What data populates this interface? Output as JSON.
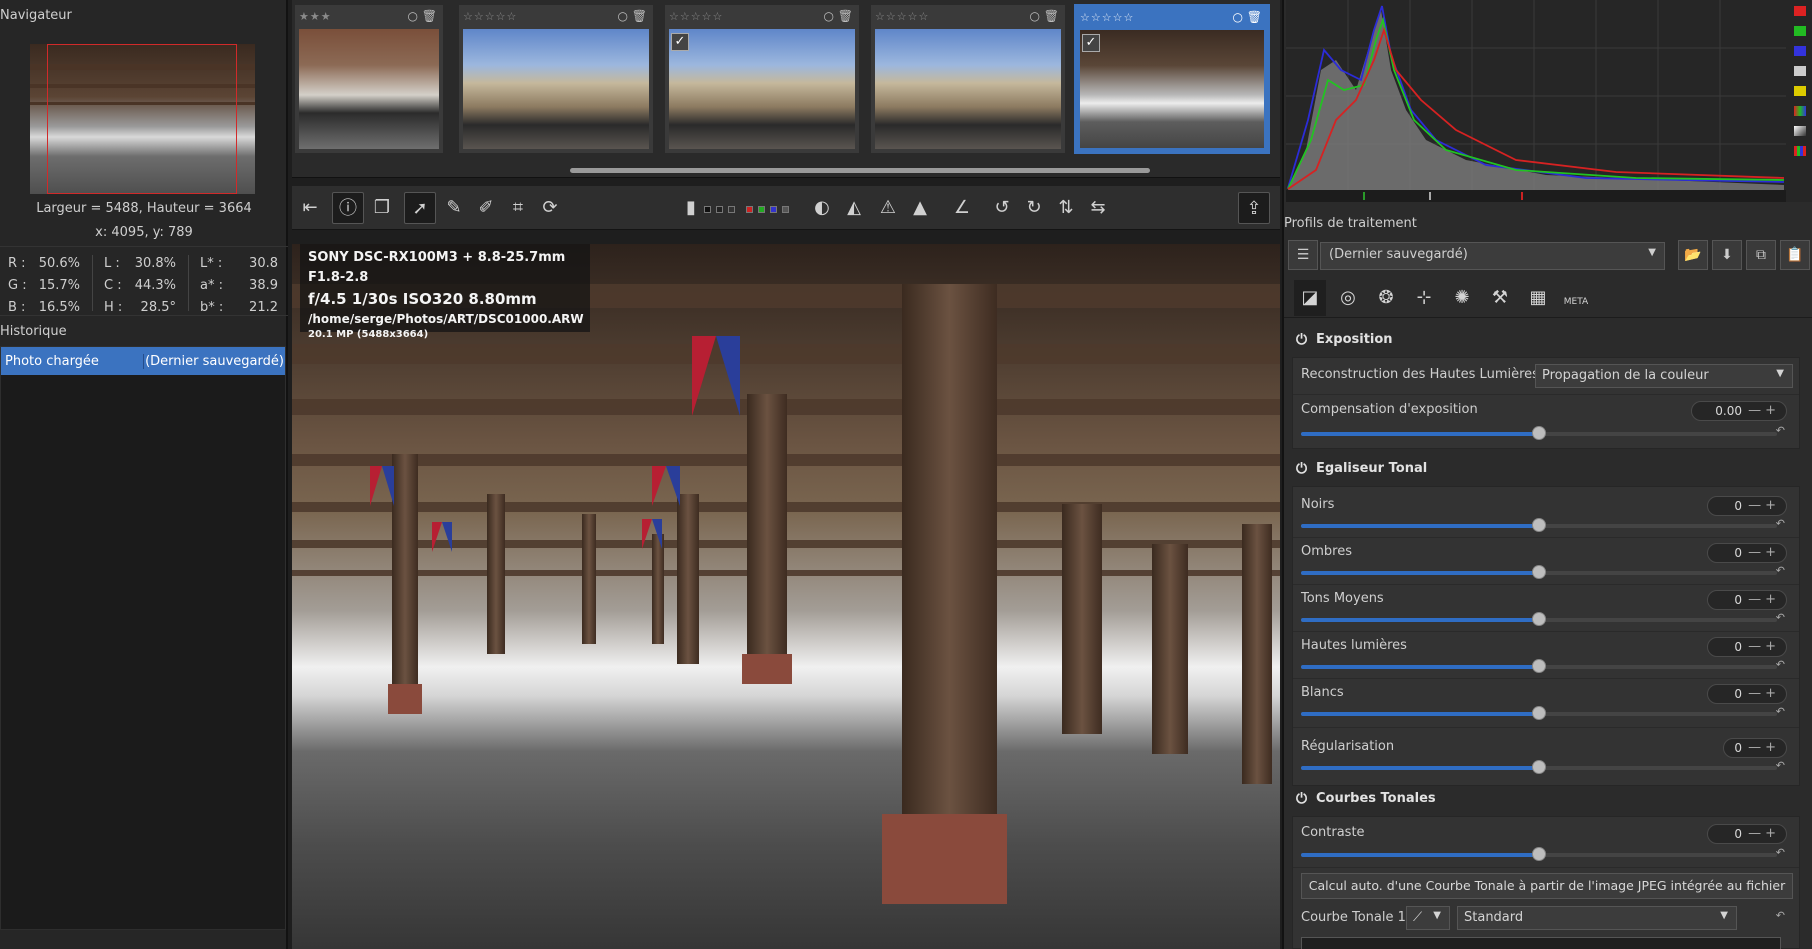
{
  "navigator": {
    "title": "Navigateur",
    "dimensions": "Largeur = 5488, Hauteur = 3664",
    "cursor": "x: 4095, y: 789",
    "rgb": [
      {
        "k": "R :",
        "v": "50.6%"
      },
      {
        "k": "G :",
        "v": "15.7%"
      },
      {
        "k": "B :",
        "v": "16.5%"
      }
    ],
    "lch": [
      {
        "k": "L :",
        "v": "30.8%"
      },
      {
        "k": "C :",
        "v": "44.3%"
      },
      {
        "k": "H :",
        "v": "28.5°"
      }
    ],
    "lab": [
      {
        "k": "L* :",
        "v": "30.8"
      },
      {
        "k": "a* :",
        "v": "38.9"
      },
      {
        "k": "b* :",
        "v": "21.2"
      }
    ]
  },
  "history": {
    "title": "Historique",
    "rows": [
      {
        "action": "Photo chargée",
        "value": "(Dernier sauvegardé)"
      }
    ]
  },
  "filmstrip": {
    "thumbs": [
      {
        "stars": "★★★",
        "kind": "town",
        "checked": false,
        "selected": false
      },
      {
        "stars": "☆☆☆☆☆",
        "kind": "opera",
        "checked": false,
        "selected": false
      },
      {
        "stars": "☆☆☆☆☆",
        "kind": "opera",
        "checked": true,
        "selected": false
      },
      {
        "stars": "☆☆☆☆☆",
        "kind": "opera",
        "checked": false,
        "selected": false
      },
      {
        "stars": "☆☆☆☆☆",
        "kind": "hall",
        "checked": true,
        "selected": true
      }
    ],
    "tools_glyph": "○ 🗑",
    "check_glyph": "✓"
  },
  "exif": {
    "camera": "SONY DSC-RX100M3 + 8.8-25.7mm F1.8-2.8",
    "exposure": "f/4.5  1/30s  ISO320  8.80mm",
    "path": "/home/serge/Photos/ART/DSC01000.ARW",
    "megapixels": "20.1 MP (5488x3664)"
  },
  "right": {
    "profiles_label": "Profils de traitement",
    "profile_value": "(Dernier sauvegardé)",
    "tabs": [
      "exposure-tab",
      "detail-tab",
      "color-tab",
      "transform-tab",
      "raw-tab",
      "advanced-tab",
      "locallab-tab",
      "metadata-tab"
    ],
    "meta_label": "META",
    "exposure": {
      "title": "Exposition",
      "hl_label": "Reconstruction des Hautes Lumières:",
      "hl_value": "Propagation de la couleur",
      "comp_label": "Compensation d'exposition",
      "comp_value": "0.00",
      "comp_fraction": 0.5
    },
    "tone_eq": {
      "title": "Egaliseur Tonal",
      "bands": [
        {
          "label": "Noirs",
          "value": "0"
        },
        {
          "label": "Ombres",
          "value": "0"
        },
        {
          "label": "Tons Moyens",
          "value": "0"
        },
        {
          "label": "Hautes lumières",
          "value": "0"
        },
        {
          "label": "Blancs",
          "value": "0"
        }
      ],
      "reg_label": "Régularisation",
      "reg_value": "0"
    },
    "curves": {
      "title": "Courbes Tonales",
      "contrast_label": "Contraste",
      "contrast_value": "0",
      "auto_button": "Calcul auto. d'une Courbe Tonale à partir de l'image JPEG intégrée au fichier raw",
      "curve1_label": "Courbe Tonale 1:",
      "curve1_mode": "Standard"
    }
  }
}
